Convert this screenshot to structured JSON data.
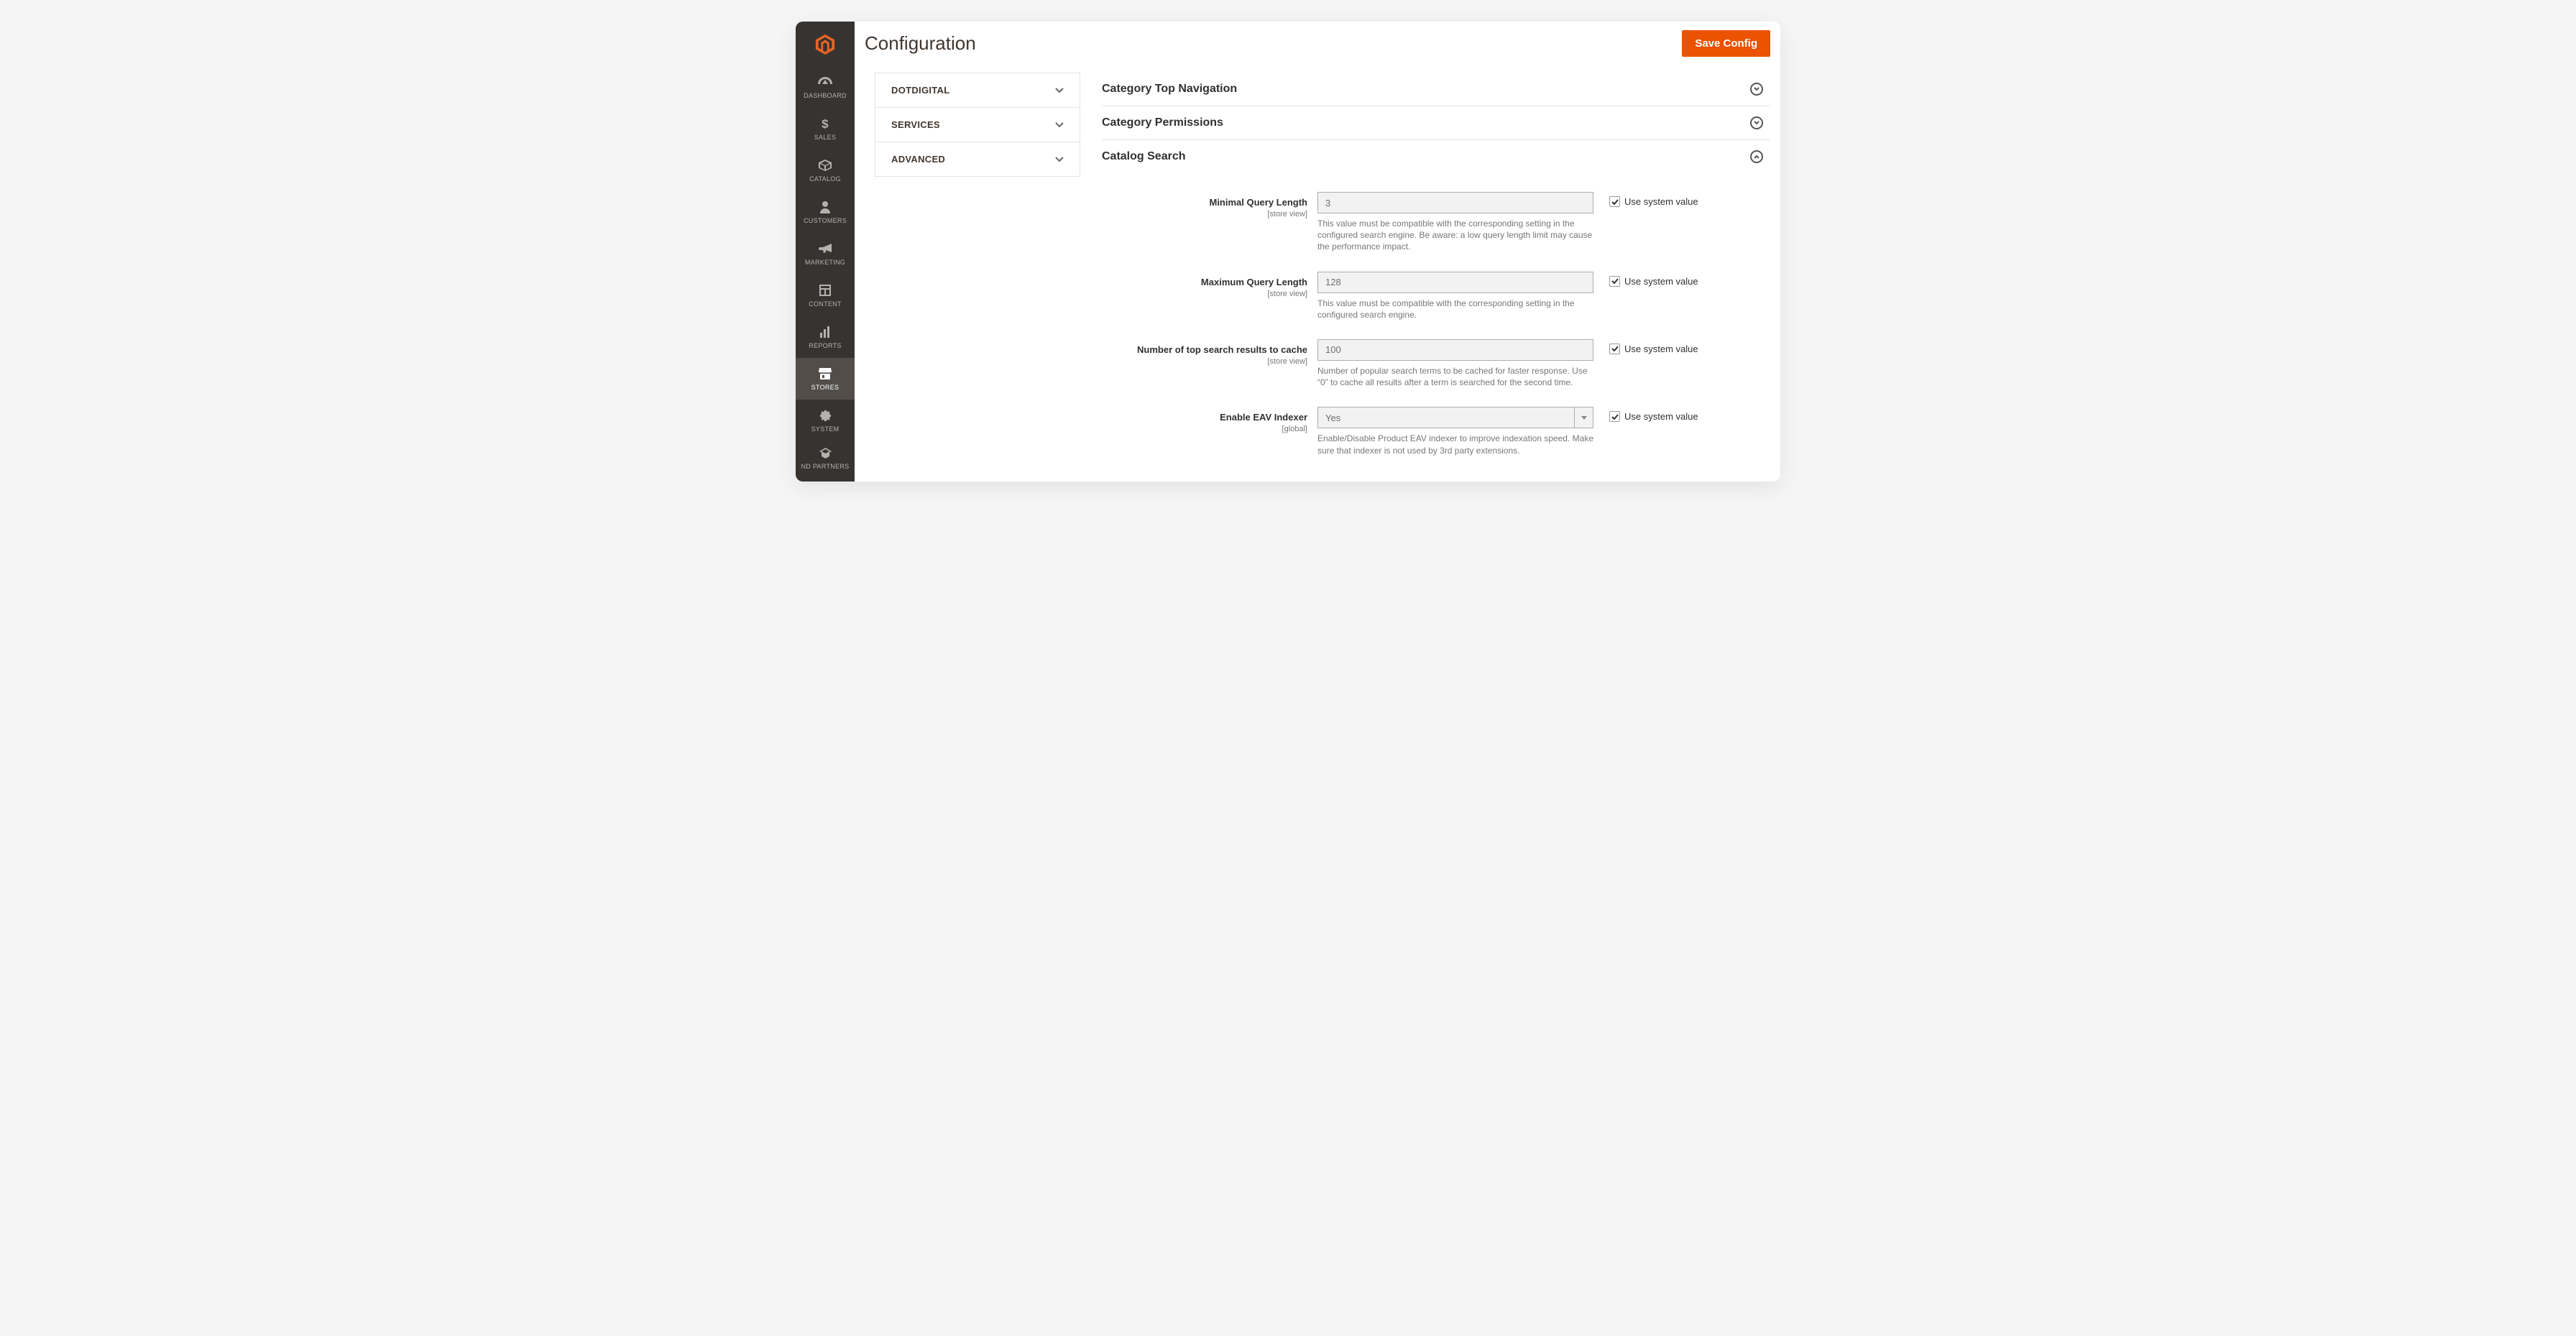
{
  "sidebar": {
    "items": [
      {
        "id": "dashboard",
        "label": "DASHBOARD"
      },
      {
        "id": "sales",
        "label": "SALES"
      },
      {
        "id": "catalog",
        "label": "CATALOG"
      },
      {
        "id": "customers",
        "label": "CUSTOMERS"
      },
      {
        "id": "marketing",
        "label": "MARKETING"
      },
      {
        "id": "content",
        "label": "CONTENT"
      },
      {
        "id": "reports",
        "label": "REPORTS"
      },
      {
        "id": "stores",
        "label": "STORES"
      },
      {
        "id": "system",
        "label": "SYSTEM"
      },
      {
        "id": "partners",
        "label": "ND PARTNERS"
      }
    ]
  },
  "header": {
    "title": "Configuration",
    "save": "Save Config"
  },
  "configNav": [
    "DOTDIGITAL",
    "SERVICES",
    "ADVANCED"
  ],
  "sections": {
    "topnav": "Category Top Navigation",
    "perms": "Category Permissions",
    "search": "Catalog Search"
  },
  "scopes": {
    "store_view": "[store view]",
    "global": "[global]"
  },
  "use_system_value": "Use system value",
  "fields": {
    "min_query": {
      "label": "Minimal Query Length",
      "value": "3",
      "note": "This value must be compatible with the corresponding setting in the configured search engine. Be aware: a low query length limit may cause the performance impact."
    },
    "max_query": {
      "label": "Maximum Query Length",
      "value": "128",
      "note": "This value must be compatible with the corresponding setting in the configured search engine."
    },
    "cache_results": {
      "label": "Number of top search results to cache",
      "value": "100",
      "note": "Number of popular search terms to be cached for faster response. Use “0” to cache all results after a term is searched for the second time."
    },
    "eav_indexer": {
      "label": "Enable EAV Indexer",
      "value": "Yes",
      "note": "Enable/Disable Product EAV indexer to improve indexation speed. Make sure that indexer is not used by 3rd party extensions."
    }
  }
}
